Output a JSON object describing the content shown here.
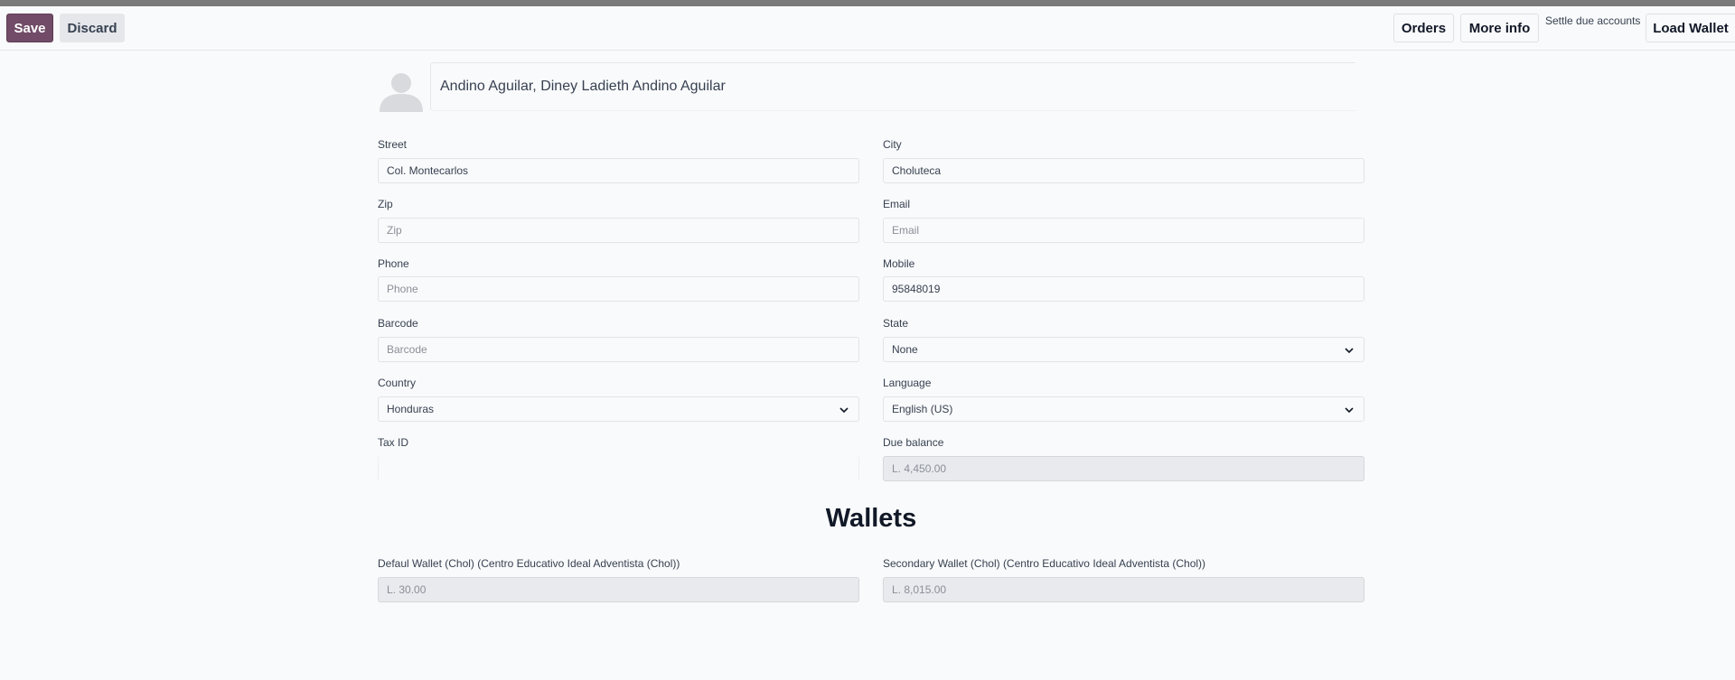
{
  "toolbar": {
    "save_label": "Save",
    "discard_label": "Discard",
    "orders_label": "Orders",
    "more_info_label": "More info",
    "settle_label": "Settle due accounts",
    "load_wallet_label": "Load Wallet"
  },
  "partner": {
    "name": "Andino Aguilar, Diney Ladieth Andino Aguilar"
  },
  "fields": {
    "street": {
      "label": "Street",
      "value": "Col. Montecarlos"
    },
    "city": {
      "label": "City",
      "value": "Choluteca"
    },
    "zip": {
      "label": "Zip",
      "placeholder": "Zip"
    },
    "email": {
      "label": "Email",
      "placeholder": "Email"
    },
    "phone": {
      "label": "Phone",
      "placeholder": "Phone"
    },
    "mobile": {
      "label": "Mobile",
      "value": "95848019"
    },
    "barcode": {
      "label": "Barcode",
      "placeholder": "Barcode"
    },
    "state": {
      "label": "State",
      "value": "None"
    },
    "country": {
      "label": "Country",
      "value": "Honduras"
    },
    "language": {
      "label": "Language",
      "value": "English (US)"
    },
    "tax_id": {
      "label": "Tax ID",
      "value": ""
    },
    "due_balance": {
      "label": "Due balance",
      "value": "L. 4,450.00"
    }
  },
  "wallets": {
    "title": "Wallets",
    "default": {
      "label": "Defaul Wallet (Chol) (Centro Educativo Ideal Adventista (Chol))",
      "value": "L. 30.00"
    },
    "secondary": {
      "label": "Secondary Wallet (Chol) (Centro Educativo Ideal Adventista (Chol))",
      "value": "L. 8,015.00"
    }
  },
  "icons": {
    "avatar": "person-placeholder-icon",
    "dropdown": "chevron-down-icon"
  },
  "colors": {
    "primary": "#714b67",
    "background": "#f9fafb",
    "readonly_field": "#e9eaee"
  }
}
